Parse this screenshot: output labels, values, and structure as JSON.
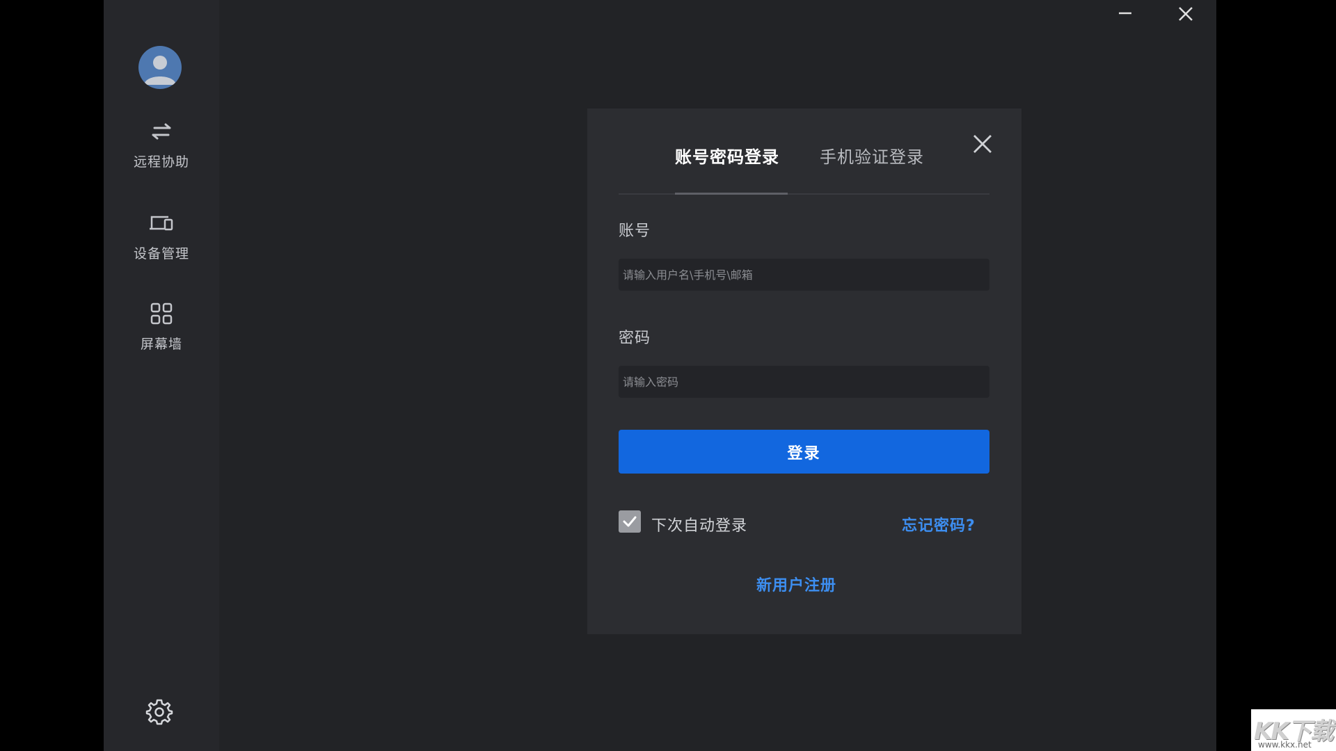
{
  "colors": {
    "background": "#222326",
    "sidebar": "#26272b",
    "dialog": "#2c2d31",
    "primary": "#1267df",
    "link": "#3d8ef0"
  },
  "sidebar": {
    "avatar_icon": "user-avatar-icon",
    "items": [
      {
        "label": "远程协助",
        "icon": "swap-arrows-icon"
      },
      {
        "label": "设备管理",
        "icon": "devices-icon"
      },
      {
        "label": "屏幕墙",
        "icon": "grid-icon"
      }
    ],
    "settings_icon": "gear-icon"
  },
  "window": {
    "minimize_icon": "minimize-icon",
    "close_icon": "close-icon"
  },
  "login": {
    "tabs": [
      {
        "label": "账号密码登录",
        "active": true
      },
      {
        "label": "手机验证登录",
        "active": false
      }
    ],
    "account_label": "账号",
    "account_placeholder": "请输入用户名\\手机号\\邮箱",
    "account_value": "",
    "password_label": "密码",
    "password_placeholder": "请输入密码",
    "password_value": "",
    "submit_label": "登录",
    "auto_login_label": "下次自动登录",
    "auto_login_checked": true,
    "forgot_label": "忘记密码?",
    "register_label": "新用户注册"
  },
  "watermark": {
    "logo": "KK下载",
    "url": "www.kkx.net"
  }
}
